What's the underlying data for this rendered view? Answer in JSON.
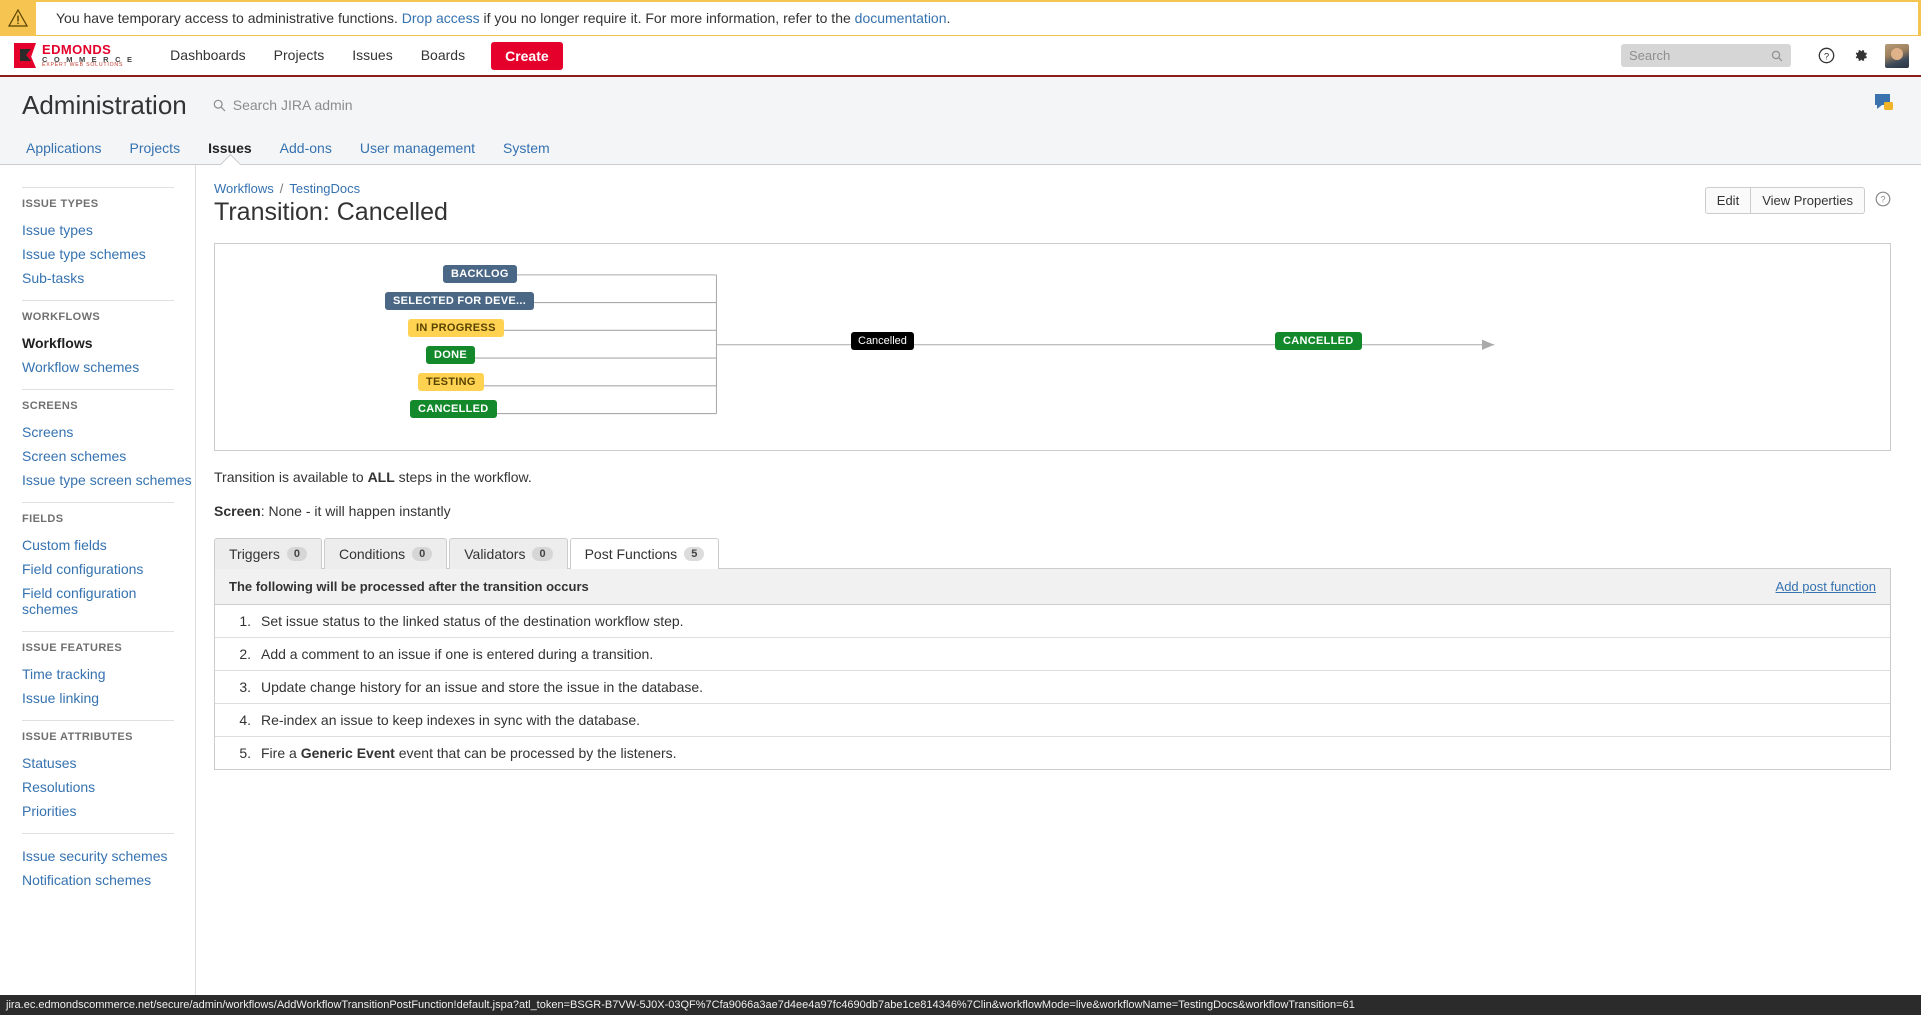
{
  "banner": {
    "icon": "warning-triangle-icon",
    "text_before": "You have temporary access to administrative functions.",
    "link_drop": "Drop access",
    "text_middle": "if you no longer require it. For more information, refer to the",
    "link_docs": "documentation",
    "text_end": ".",
    "bg_color": "#f5c451"
  },
  "topnav": {
    "logo": {
      "line1": "EDMONDS",
      "line2": "C O M M E R C E",
      "line3": "EXPERT WEB SOLUTIONS"
    },
    "links": [
      {
        "label": "Dashboards"
      },
      {
        "label": "Projects"
      },
      {
        "label": "Issues"
      },
      {
        "label": "Boards"
      }
    ],
    "create_label": "Create",
    "create_color": "#e4002b",
    "search_placeholder": "Search",
    "help_icon": "question-circle-icon",
    "settings_icon": "gear-icon",
    "avatar": "user-avatar"
  },
  "admin_header": {
    "title": "Administration",
    "search_placeholder": "Search JIRA admin",
    "search_icon": "search-icon",
    "notification_icon": "feedback-icon"
  },
  "admin_tabs": [
    {
      "label": "Applications",
      "active": false
    },
    {
      "label": "Projects",
      "active": false
    },
    {
      "label": "Issues",
      "active": true
    },
    {
      "label": "Add-ons",
      "active": false
    },
    {
      "label": "User management",
      "active": false
    },
    {
      "label": "System",
      "active": false
    }
  ],
  "sidebar": [
    {
      "heading": "ISSUE TYPES",
      "items": [
        {
          "label": "Issue types",
          "active": false
        },
        {
          "label": "Issue type schemes",
          "active": false
        },
        {
          "label": "Sub-tasks",
          "active": false
        }
      ]
    },
    {
      "heading": "WORKFLOWS",
      "items": [
        {
          "label": "Workflows",
          "active": true
        },
        {
          "label": "Workflow schemes",
          "active": false
        }
      ]
    },
    {
      "heading": "SCREENS",
      "items": [
        {
          "label": "Screens",
          "active": false
        },
        {
          "label": "Screen schemes",
          "active": false
        },
        {
          "label": "Issue type screen schemes",
          "active": false
        }
      ]
    },
    {
      "heading": "FIELDS",
      "items": [
        {
          "label": "Custom fields",
          "active": false
        },
        {
          "label": "Field configurations",
          "active": false
        },
        {
          "label": "Field configuration schemes",
          "active": false
        }
      ]
    },
    {
      "heading": "ISSUE FEATURES",
      "items": [
        {
          "label": "Time tracking",
          "active": false
        },
        {
          "label": "Issue linking",
          "active": false
        }
      ]
    },
    {
      "heading": "ISSUE ATTRIBUTES",
      "items": [
        {
          "label": "Statuses",
          "active": false
        },
        {
          "label": "Resolutions",
          "active": false
        },
        {
          "label": "Priorities",
          "active": false
        }
      ]
    },
    {
      "heading": "",
      "items": [
        {
          "label": "Issue security schemes",
          "active": false
        },
        {
          "label": "Notification schemes",
          "active": false
        }
      ]
    }
  ],
  "breadcrumb": {
    "item1": "Workflows",
    "separator": "/",
    "item2": "TestingDocs"
  },
  "page": {
    "title": "Transition: Cancelled",
    "edit_label": "Edit",
    "view_properties_label": "View Properties",
    "help_icon": "question-circle-icon"
  },
  "workflow_diagram": {
    "source_steps": [
      {
        "label": "BACKLOG",
        "color": "blue"
      },
      {
        "label": "SELECTED FOR DEVE...",
        "color": "blue"
      },
      {
        "label": "IN PROGRESS",
        "color": "yellow"
      },
      {
        "label": "DONE",
        "color": "green"
      },
      {
        "label": "TESTING",
        "color": "yellow"
      },
      {
        "label": "CANCELLED",
        "color": "green"
      }
    ],
    "transition_label": "Cancelled",
    "destination": {
      "label": "CANCELLED",
      "color": "green"
    },
    "colors": {
      "blue": "#4a6785",
      "yellow": "#ffd351",
      "green": "#14892c",
      "black": "#000000"
    }
  },
  "info": {
    "availability_prefix": "Transition is available to",
    "availability_strong": "ALL",
    "availability_suffix": "steps in the workflow.",
    "screen_label": "Screen",
    "screen_value": ": None - it will happen instantly"
  },
  "function_tabs": [
    {
      "label": "Triggers",
      "count": "0",
      "active": false
    },
    {
      "label": "Conditions",
      "count": "0",
      "active": false
    },
    {
      "label": "Validators",
      "count": "0",
      "active": false
    },
    {
      "label": "Post Functions",
      "count": "5",
      "active": true
    }
  ],
  "post_functions_panel": {
    "heading": "The following will be processed after the transition occurs",
    "add_link": "Add post function",
    "rows": [
      {
        "num": "1.",
        "text": "Set issue status to the linked status of the destination workflow step."
      },
      {
        "num": "2.",
        "text": "Add a comment to an issue if one is entered during a transition."
      },
      {
        "num": "3.",
        "text": "Update change history for an issue and store the issue in the database."
      },
      {
        "num": "4.",
        "text": "Re-index an issue to keep indexes in sync with the database."
      },
      {
        "num": "5.",
        "text_prefix": "Fire a",
        "text_strong": "Generic Event",
        "text_suffix": "event that can be processed by the listeners."
      }
    ]
  },
  "statusbar": {
    "url": "jira.ec.edmondscommerce.net/secure/admin/workflows/AddWorkflowTransitionPostFunction!default.jspa?atl_token=BSGR-B7VW-5J0X-03QF%7Cfa9066a3ae7d4ee4a97fc4690db7abe1ce814346%7Clin&workflowMode=live&workflowName=TestingDocs&workflowTransition=61"
  }
}
